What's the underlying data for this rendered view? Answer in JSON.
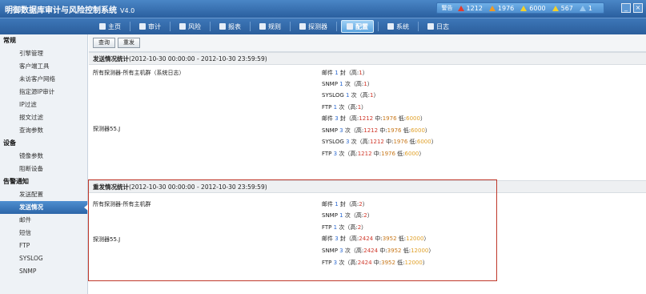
{
  "app": {
    "title": "明御数据库审计与风险控制系统",
    "version": "V4.0"
  },
  "alarms": {
    "label": "警告",
    "counts": [
      {
        "value": "1212",
        "color": "#e23b2e"
      },
      {
        "value": "1976",
        "color": "#f09a24"
      },
      {
        "value": "6000",
        "color": "#f3d12a"
      },
      {
        "value": "567",
        "color": "#f3d12a"
      },
      {
        "value": "1",
        "color": "#9cc9f0"
      }
    ]
  },
  "nav": [
    {
      "label": "主页",
      "icon": "home-icon"
    },
    {
      "label": "审计",
      "icon": "audit-icon"
    },
    {
      "label": "风险",
      "icon": "warning-icon"
    },
    {
      "label": "报表",
      "icon": "report-icon"
    },
    {
      "label": "规则",
      "icon": "rule-icon"
    },
    {
      "label": "探测器",
      "icon": "probe-icon"
    },
    {
      "label": "配置",
      "icon": "config-icon",
      "active": true
    },
    {
      "label": "系统",
      "icon": "system-icon"
    },
    {
      "label": "日志",
      "icon": "log-icon"
    }
  ],
  "sidebar": {
    "groups": [
      {
        "title": "常规",
        "items": [
          "引擎管理",
          "客户端工具",
          "未访客户网络",
          "指定源IP审计",
          "IP过滤",
          "报文过滤",
          "查询参数"
        ]
      },
      {
        "title": "设备",
        "items": [
          "镜像参数",
          "阻断设备"
        ]
      },
      {
        "title": "告警通知",
        "items": [
          "发送配置",
          "发送情况",
          "邮件",
          "短信",
          "FTP",
          "SYSLOG",
          "SNMP"
        ]
      }
    ],
    "active": "发送情况"
  },
  "toolbar": {
    "query": "查询",
    "resend": "重发"
  },
  "section1": {
    "title": "发送情况统计",
    "range": "(2012-10-30 00:00:00 - 2012-10-30 23:59:59)",
    "left1": "所有探测器-所有主机群（系统日志）",
    "left2": "探测器55.J",
    "lines": [
      {
        "pre": "邮件",
        "n": "1",
        "unit": "封（高:",
        "h": "1",
        "post": "）"
      },
      {
        "pre": "SNMP",
        "n": "1",
        "unit": "次（高:",
        "h": "1",
        "post": "）"
      },
      {
        "pre": "SYSLOG",
        "n": "1",
        "unit": "次（高:",
        "h": "1",
        "post": "）"
      },
      {
        "pre": "FTP",
        "n": "1",
        "unit": "次（高:",
        "h": "1",
        "post": "）"
      },
      {
        "pre": "邮件",
        "n": "3",
        "unit": "封（高:",
        "h": "1212",
        "m": "1976",
        "l": "6000",
        "post": "）"
      },
      {
        "pre": "SNMP",
        "n": "3",
        "unit": "次（高:",
        "h": "1212",
        "m": "1976",
        "l": "6000",
        "post": "）"
      },
      {
        "pre": "SYSLOG",
        "n": "3",
        "unit": "次（高:",
        "h": "1212",
        "m": "1976",
        "l": "6000",
        "post": "）"
      },
      {
        "pre": "FTP",
        "n": "3",
        "unit": "次（高:",
        "h": "1212",
        "m": "1976",
        "l": "6000",
        "post": "）"
      }
    ]
  },
  "section2": {
    "title": "重发情况统计",
    "range": "(2012-10-30 00:00:00 - 2012-10-30 23:59:59)",
    "left1": "所有探测器-所有主机群",
    "left2": "探测器55.J",
    "lines": [
      {
        "pre": "邮件",
        "n": "1",
        "unit": "封（高:",
        "h": "2",
        "post": "）"
      },
      {
        "pre": "SNMP",
        "n": "1",
        "unit": "次（高:",
        "h": "2",
        "post": "）"
      },
      {
        "pre": "FTP",
        "n": "1",
        "unit": "次（高:",
        "h": "2",
        "post": "）"
      },
      {
        "pre": "邮件",
        "n": "3",
        "unit": "封（高:",
        "h": "2424",
        "m": "3952",
        "l": "12000",
        "post": "）"
      },
      {
        "pre": "SNMP",
        "n": "3",
        "unit": "次（高:",
        "h": "2424",
        "m": "3952",
        "l": "12000",
        "post": "）"
      },
      {
        "pre": "FTP",
        "n": "3",
        "unit": "次（高:",
        "h": "2424",
        "m": "3952",
        "l": "12000",
        "post": "）"
      }
    ]
  },
  "labels": {
    "mid": "中:",
    "low": "低:"
  }
}
